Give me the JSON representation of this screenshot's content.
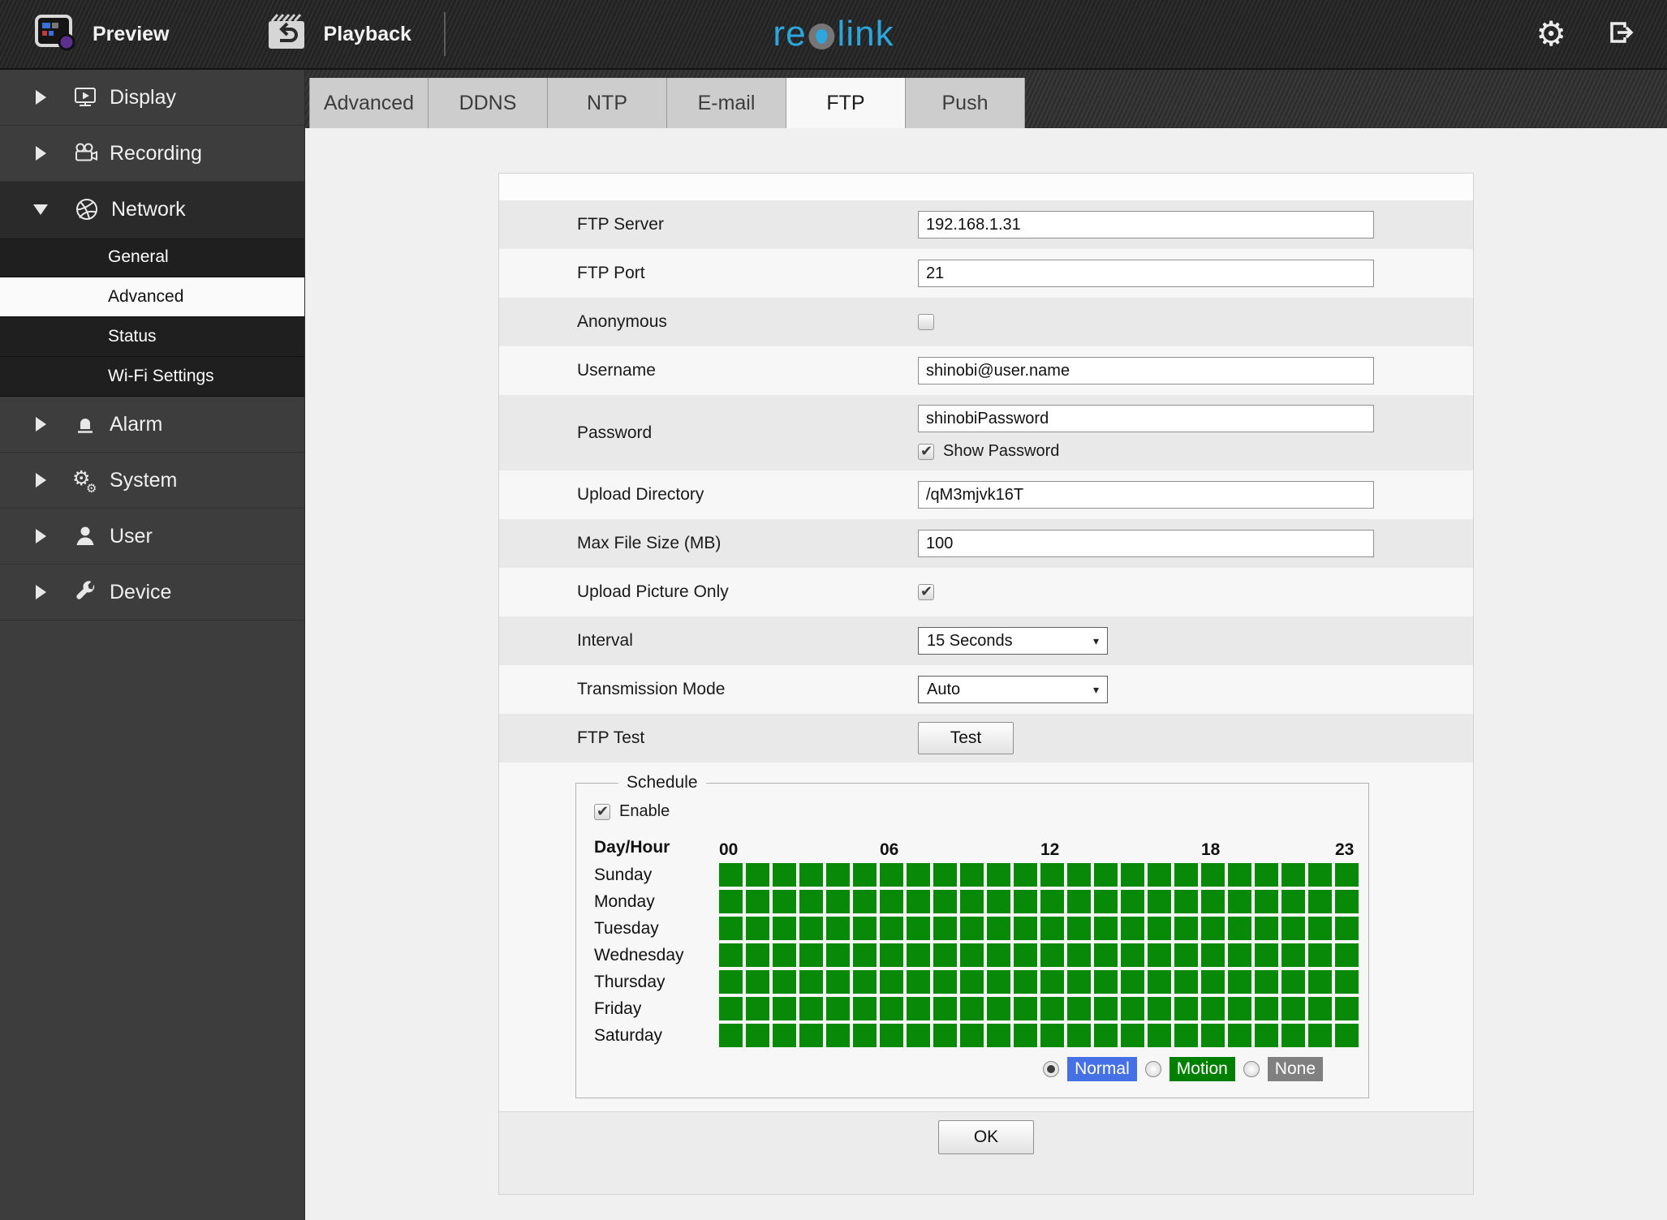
{
  "topbar": {
    "preview_label": "Preview",
    "playback_label": "Playback",
    "logo_left": "re",
    "logo_right": "link",
    "logo_color": "#2ba7de",
    "icons": [
      "preview-icon",
      "playback-icon",
      "gear-icon",
      "logout-icon"
    ]
  },
  "sidebar": {
    "items": [
      {
        "label": "Display",
        "icon": "display-icon",
        "state": "collapsed"
      },
      {
        "label": "Recording",
        "icon": "recording-icon",
        "state": "collapsed"
      },
      {
        "label": "Network",
        "icon": "network-icon",
        "state": "expanded",
        "children": [
          {
            "label": "General",
            "selected": false
          },
          {
            "label": "Advanced",
            "selected": true
          },
          {
            "label": "Status",
            "selected": false
          },
          {
            "label": "Wi-Fi Settings",
            "selected": false
          }
        ]
      },
      {
        "label": "Alarm",
        "icon": "alarm-icon",
        "state": "collapsed"
      },
      {
        "label": "System",
        "icon": "system-icon",
        "state": "collapsed"
      },
      {
        "label": "User",
        "icon": "user-icon",
        "state": "collapsed"
      },
      {
        "label": "Device",
        "icon": "device-icon",
        "state": "collapsed"
      }
    ]
  },
  "tabs": {
    "items": [
      {
        "label": "Advanced",
        "active": false
      },
      {
        "label": "DDNS",
        "active": false
      },
      {
        "label": "NTP",
        "active": false
      },
      {
        "label": "E-mail",
        "active": false
      },
      {
        "label": "FTP",
        "active": true
      },
      {
        "label": "Push",
        "active": false
      }
    ]
  },
  "form": {
    "rows": [
      {
        "label": "FTP Server",
        "type": "text",
        "value": "192.168.1.31"
      },
      {
        "label": "FTP Port",
        "type": "text",
        "value": "21"
      },
      {
        "label": "Anonymous",
        "type": "checkbox",
        "checked": false
      },
      {
        "label": "Username",
        "type": "text",
        "value": "shinobi@user.name"
      },
      {
        "label": "Password",
        "type": "text",
        "value": "shinobiPassword",
        "extra_checkbox": {
          "label": "Show Password",
          "checked": true
        }
      },
      {
        "label": "Upload Directory",
        "type": "text",
        "value": "/qM3mjvk16T"
      },
      {
        "label": "Max File Size (MB)",
        "type": "text",
        "value": "100"
      },
      {
        "label": "Upload Picture Only",
        "type": "checkbox",
        "checked": true
      },
      {
        "label": "Interval",
        "type": "select",
        "value": "15 Seconds"
      },
      {
        "label": "Transmission Mode",
        "type": "select",
        "value": "Auto"
      },
      {
        "label": "FTP Test",
        "type": "button",
        "value": "Test"
      }
    ],
    "ok_label": "OK"
  },
  "schedule": {
    "legend": "Schedule",
    "enable_label": "Enable",
    "enable_checked": true,
    "corner_label": "Day/Hour",
    "columns": 24,
    "hour_labels": [
      {
        "label": "00",
        "col": 0
      },
      {
        "label": "06",
        "col": 6
      },
      {
        "label": "12",
        "col": 12
      },
      {
        "label": "18",
        "col": 18
      },
      {
        "label": "23",
        "col": 23
      }
    ],
    "days": [
      "Sunday",
      "Monday",
      "Tuesday",
      "Wednesday",
      "Thursday",
      "Friday",
      "Saturday"
    ],
    "cells": [
      "111111111111111111111111",
      "111111111111111111111111",
      "111111111111111111111111",
      "111111111111111111111111",
      "111111111111111111111111",
      "111111111111111111111111",
      "111111111111111111111111"
    ],
    "cell_on_color": "#088a08",
    "modes": [
      {
        "label": "Normal",
        "color": "#4570e6",
        "selected": true
      },
      {
        "label": "Motion",
        "color": "#008000",
        "selected": false
      },
      {
        "label": "None",
        "color": "#808080",
        "selected": false
      }
    ]
  }
}
